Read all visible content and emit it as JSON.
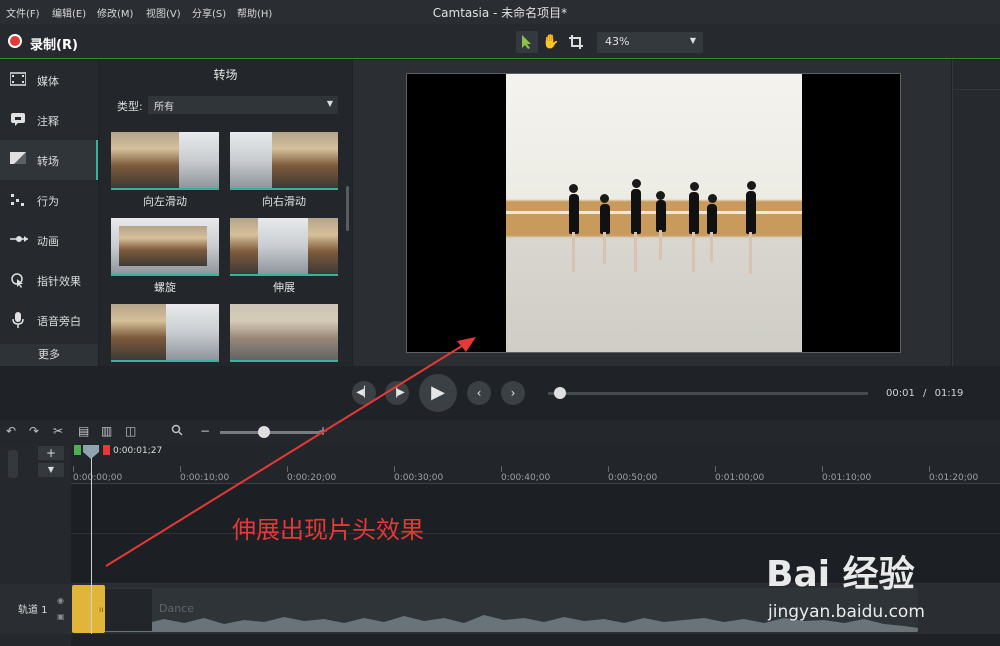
{
  "menu": [
    {
      "label": "文件(F)"
    },
    {
      "label": "编辑(E)"
    },
    {
      "label": "修改(M)"
    },
    {
      "label": "视图(V)"
    },
    {
      "label": "分享(S)"
    },
    {
      "label": "帮助(H)"
    }
  ],
  "app_title": "Camtasia - 未命名项目*",
  "toolbar": {
    "record_label": "录制(R)",
    "zoom_value": "43%"
  },
  "sidebar": {
    "items": [
      {
        "label": "媒体",
        "icon": "film-icon"
      },
      {
        "label": "注释",
        "icon": "annotation-icon"
      },
      {
        "label": "转场",
        "icon": "transition-icon"
      },
      {
        "label": "行为",
        "icon": "behavior-icon"
      },
      {
        "label": "动画",
        "icon": "animation-icon"
      },
      {
        "label": "指针效果",
        "icon": "cursor-effect-icon"
      },
      {
        "label": "语音旁白",
        "icon": "microphone-icon"
      }
    ],
    "active": "转场",
    "more_label": "更多"
  },
  "transitions": {
    "title": "转场",
    "type_label": "类型:",
    "type_value": "所有",
    "items": [
      {
        "label": "向左滑动"
      },
      {
        "label": "向右滑动"
      },
      {
        "label": "螺旋"
      },
      {
        "label": "伸展"
      },
      {
        "label": ""
      },
      {
        "label": ""
      }
    ]
  },
  "playback": {
    "current_time": "00:01",
    "separator": "/",
    "total_time": "01:19",
    "progress": 0.02
  },
  "timeline": {
    "playhead_time": "0:00:01;27",
    "ruler": [
      "0:00:00;00",
      "0:00:10;00",
      "0:00:20;00",
      "0:00:30;00",
      "0:00:40;00",
      "0:00:50;00",
      "0:01:00;00",
      "0:01:10;00",
      "0:01:20;00"
    ],
    "track_label": "轨道 1",
    "clip_name": "Dance",
    "add_track": "+"
  },
  "annotation": {
    "text": "伸展出现片头效果",
    "color": "#e53935"
  },
  "watermark": {
    "logo": "Bai 经验",
    "url": "jingyan.baidu.com"
  },
  "colors": {
    "accent": "#35b3a0",
    "record": "#e53935",
    "transition_clip": "#e0b53a"
  }
}
